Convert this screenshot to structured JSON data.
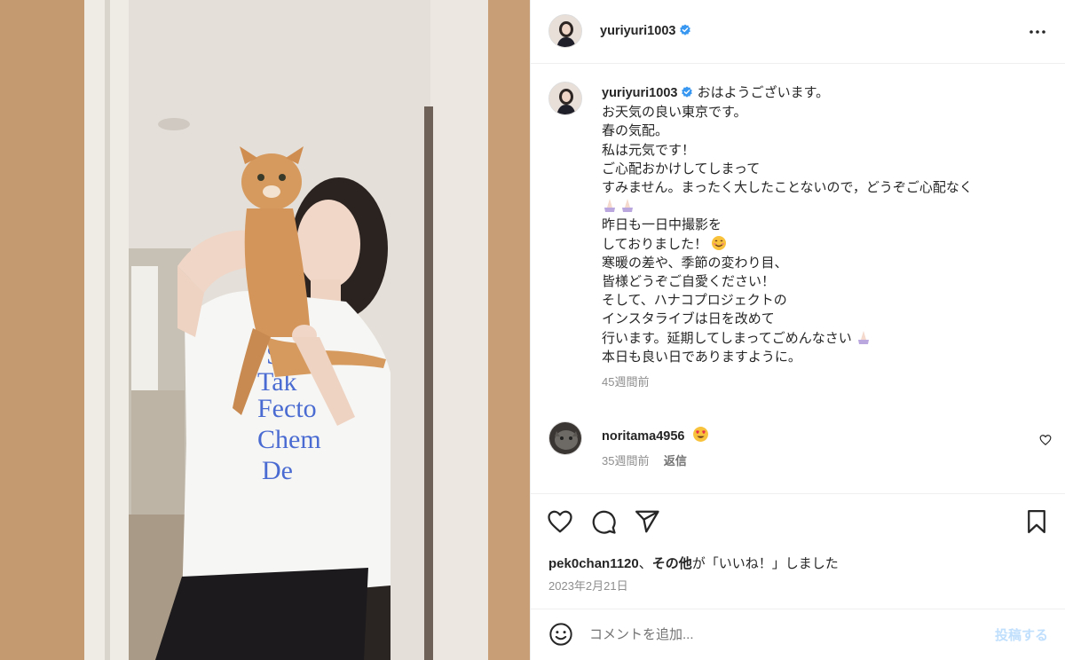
{
  "post": {
    "author": "yuriyuri1003",
    "more_icon": "more-horizontal-icon"
  },
  "caption": {
    "author": "yuriyuri1003",
    "lines": [
      "おはようございます。",
      "お天気の良い東京です。",
      "春の気配。",
      "私は元気です！",
      "ご心配おかけしてしまって",
      "すみません。まったく大したことないので，どうぞご心配なく",
      "",
      "昨日も一日中撮影を",
      "しておりました！",
      "寒暖の差や、季節の変わり目、",
      "皆様どうぞご自愛ください！",
      "そして、ハナコプロジェクトの",
      "インスタライブは日を改めて",
      "行います。延期してしまってごめんなさい",
      "本日も良い日でありますように。"
    ],
    "time": "45週間前"
  },
  "comment": {
    "username": "noritama4956",
    "time": "35週間前",
    "reply_label": "返信"
  },
  "actions": {
    "like_icon": "heart-icon",
    "comment_icon": "comment-icon",
    "share_icon": "share-icon",
    "save_icon": "bookmark-icon"
  },
  "likes": {
    "user": "pek0chan1120",
    "separator": "、",
    "others": "その他",
    "suffix": "が「いいね！」しました"
  },
  "date": "2023年2月21日",
  "comment_box": {
    "placeholder": "コメントを追加...",
    "post_label": "投稿する"
  },
  "colors": {
    "verified": "#3897f0",
    "text": "#262626",
    "secondary": "#8e8e8e",
    "post_button": "#c0dffd"
  }
}
